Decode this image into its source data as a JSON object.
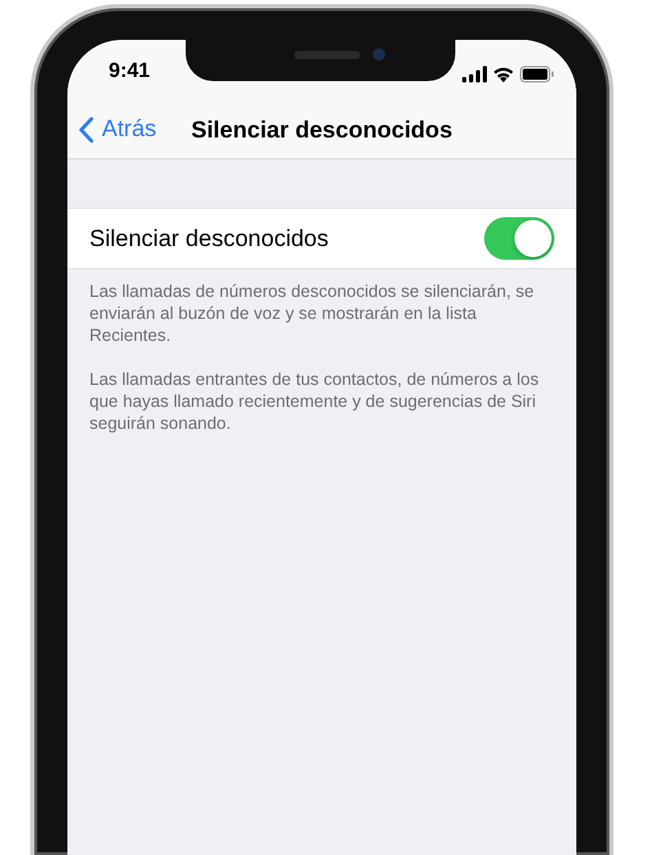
{
  "status_bar": {
    "time": "9:41"
  },
  "nav_bar": {
    "back": "Atrás",
    "title": "Silenciar desconocidos"
  },
  "setting": {
    "label": "Silenciar desconocidos",
    "on": true
  },
  "footer": [
    "Las llamadas de números desconocidos se silenciarán, se enviarán al buzón de voz y se mostrarán en la lista Recientes.",
    "Las llamadas entrantes de tus contactos, de números a los que hayas llamado recientemente y de sugerencias de Siri seguirán sonando."
  ]
}
